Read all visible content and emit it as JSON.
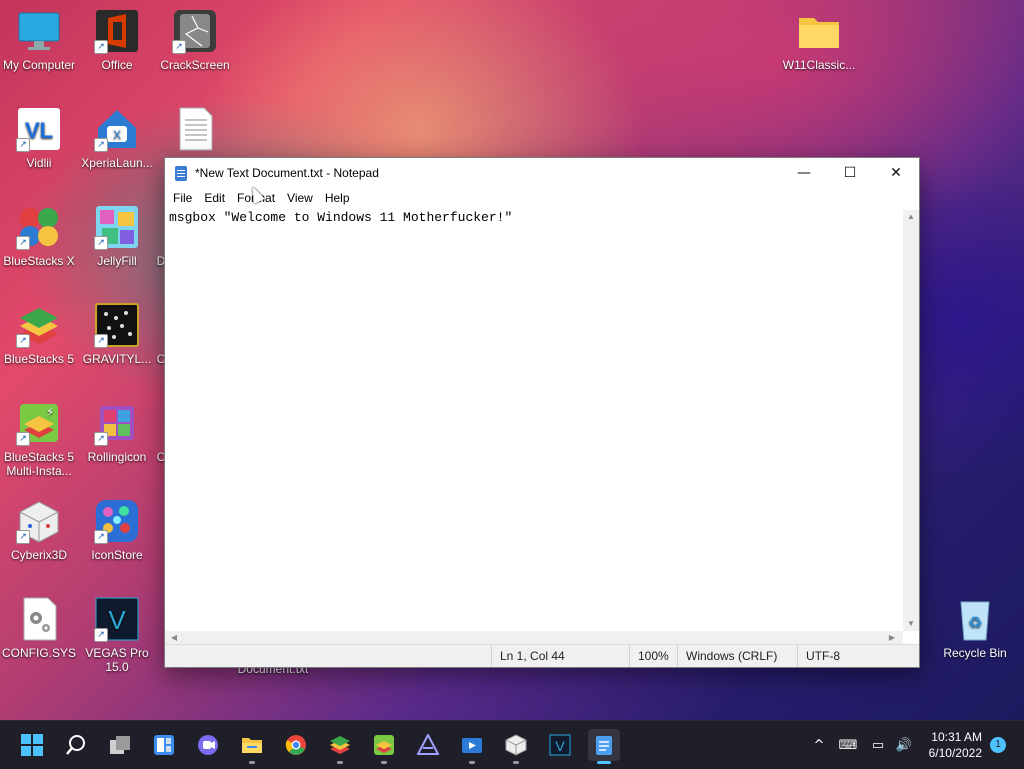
{
  "desktop": {
    "icons": [
      {
        "label": "My Computer",
        "icon": "monitor-icon",
        "color": "#29a9e0"
      },
      {
        "label": "Office",
        "icon": "office-icon",
        "color": "#d83b01"
      },
      {
        "label": "CrackScreen",
        "icon": "crackscreen-icon",
        "color": "#555555"
      },
      {
        "label": "W11Classic...",
        "icon": "folder-icon",
        "color": "#f5c542"
      },
      {
        "label": "Vidlii",
        "icon": "vidlii-icon",
        "color": "#1e6fd9"
      },
      {
        "label": "XperiaLaun...",
        "icon": "xperia-home-icon",
        "color": "#2a7bd1"
      },
      {
        "label": "",
        "icon": "text-file-icon",
        "color": "#ffffff"
      },
      {
        "label": "BlueStacks X",
        "icon": "bluestacks-x-icon",
        "color": "#e04040"
      },
      {
        "label": "JellyFill",
        "icon": "jellyfill-icon",
        "color": "#c040e0"
      },
      {
        "label": "D",
        "icon": "partial-icon",
        "color": "#444444"
      },
      {
        "label": "BlueStacks 5",
        "icon": "bluestacks5-icon",
        "color": "#3aa84a"
      },
      {
        "label": "GRAVITYL...",
        "icon": "gravity-icon",
        "color": "#222222"
      },
      {
        "label": "C",
        "icon": "partial-icon",
        "color": "#444444"
      },
      {
        "label": "BlueStacks 5 Multi-Insta...",
        "icon": "bluestacks-multi-icon",
        "color": "#7ac943"
      },
      {
        "label": "Rollingicon",
        "icon": "rollingicon-icon",
        "color": "#a050c0"
      },
      {
        "label": "C",
        "icon": "partial-icon",
        "color": "#444444"
      },
      {
        "label": "Cyberix3D",
        "icon": "cyberix3d-icon",
        "color": "#dddddd"
      },
      {
        "label": "IconStore",
        "icon": "iconstore-icon",
        "color": "#2b6fd6"
      },
      {
        "label": "CONFIG.SYS",
        "icon": "config-file-icon",
        "color": "#eeeeee"
      },
      {
        "label": "VEGAS Pro 15.0",
        "icon": "vegas-icon",
        "color": "#0f1b2d"
      },
      {
        "label": "Document.txt",
        "icon": "document-icon",
        "color": "#dddddd"
      },
      {
        "label": "Recycle Bin",
        "icon": "recycle-bin-icon",
        "color": "#8fc8f0"
      }
    ]
  },
  "notepad": {
    "title": "*New Text Document.txt - Notepad",
    "controls": {
      "minimize": "—",
      "maximize": "☐",
      "close": "✕"
    },
    "menu": [
      "File",
      "Edit",
      "Format",
      "View",
      "Help"
    ],
    "content": "msgbox \"Welcome to Windows 11 Motherfucker!\"",
    "status": {
      "position": "Ln 1, Col 44",
      "zoom": "100%",
      "line_ending": "Windows (CRLF)",
      "encoding": "UTF-8"
    }
  },
  "taskbar": {
    "apps": [
      {
        "icon": "start-icon",
        "color": "#4cc2ff"
      },
      {
        "icon": "search-icon",
        "color": "#ffffff"
      },
      {
        "icon": "task-view-icon",
        "color": "#cfcfcf"
      },
      {
        "icon": "widgets-icon",
        "color": "#3b8ef0"
      },
      {
        "icon": "teams-chat-icon",
        "color": "#7b6cf0"
      },
      {
        "icon": "file-explorer-icon",
        "color": "#f5c542"
      },
      {
        "icon": "chrome-icon",
        "color": "#e8453c"
      },
      {
        "icon": "bluestacks-icon",
        "color": "#3aa84a"
      },
      {
        "icon": "bluestacks-multi-icon",
        "color": "#7ac943"
      },
      {
        "icon": "affinity-icon",
        "color": "#7f7fff"
      },
      {
        "icon": "movie-maker-icon",
        "color": "#2b7bd6"
      },
      {
        "icon": "cyberix3d-icon",
        "color": "#dddddd"
      },
      {
        "icon": "vegas-icon",
        "color": "#2ba8d6"
      },
      {
        "icon": "notepad-icon",
        "color": "#4c9ff0"
      }
    ],
    "tray": {
      "chevron": "^",
      "keyboard": "⌨",
      "network": "▭",
      "volume": "🔊"
    },
    "time": "10:31 AM",
    "date": "6/10/2022",
    "notifications": "1"
  }
}
